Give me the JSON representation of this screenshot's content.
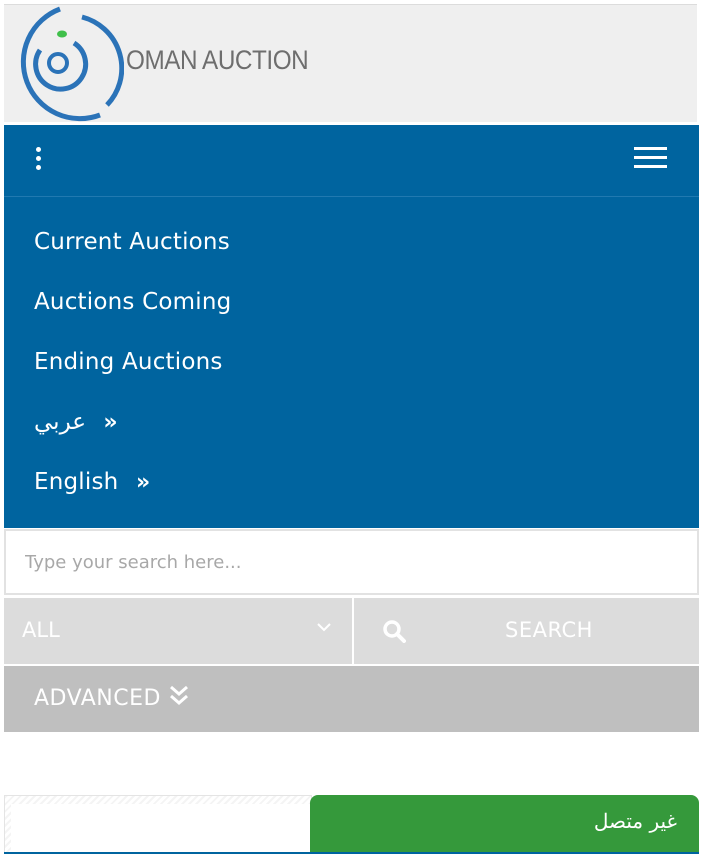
{
  "header": {
    "logo_text": "OMAN AUCTION",
    "colors": {
      "logo_blue": "#2b73b8",
      "logo_green": "#3fbf4a",
      "background": "#efefef"
    }
  },
  "navbar": {
    "background": "#00649f",
    "kebab_icon": "kebab-menu-icon",
    "hamburger_icon": "hamburger-icon",
    "items": [
      {
        "label": "Current Auctions"
      },
      {
        "label": "Auctions Coming"
      },
      {
        "label": "Ending Auctions"
      },
      {
        "label": "عربي",
        "icon": "double-chevron-right-icon"
      },
      {
        "label": "English",
        "icon": "double-chevron-right-icon"
      }
    ]
  },
  "search": {
    "placeholder": "Type your search here...",
    "value": "",
    "category_selected": "ALL",
    "button_label": "SEARCH",
    "button_icon": "search-icon"
  },
  "advanced": {
    "label": "ADVANCED",
    "icon": "double-chevron-down-icon"
  },
  "chat": {
    "status_text": "غير متصل",
    "status_color": "#35993b"
  }
}
